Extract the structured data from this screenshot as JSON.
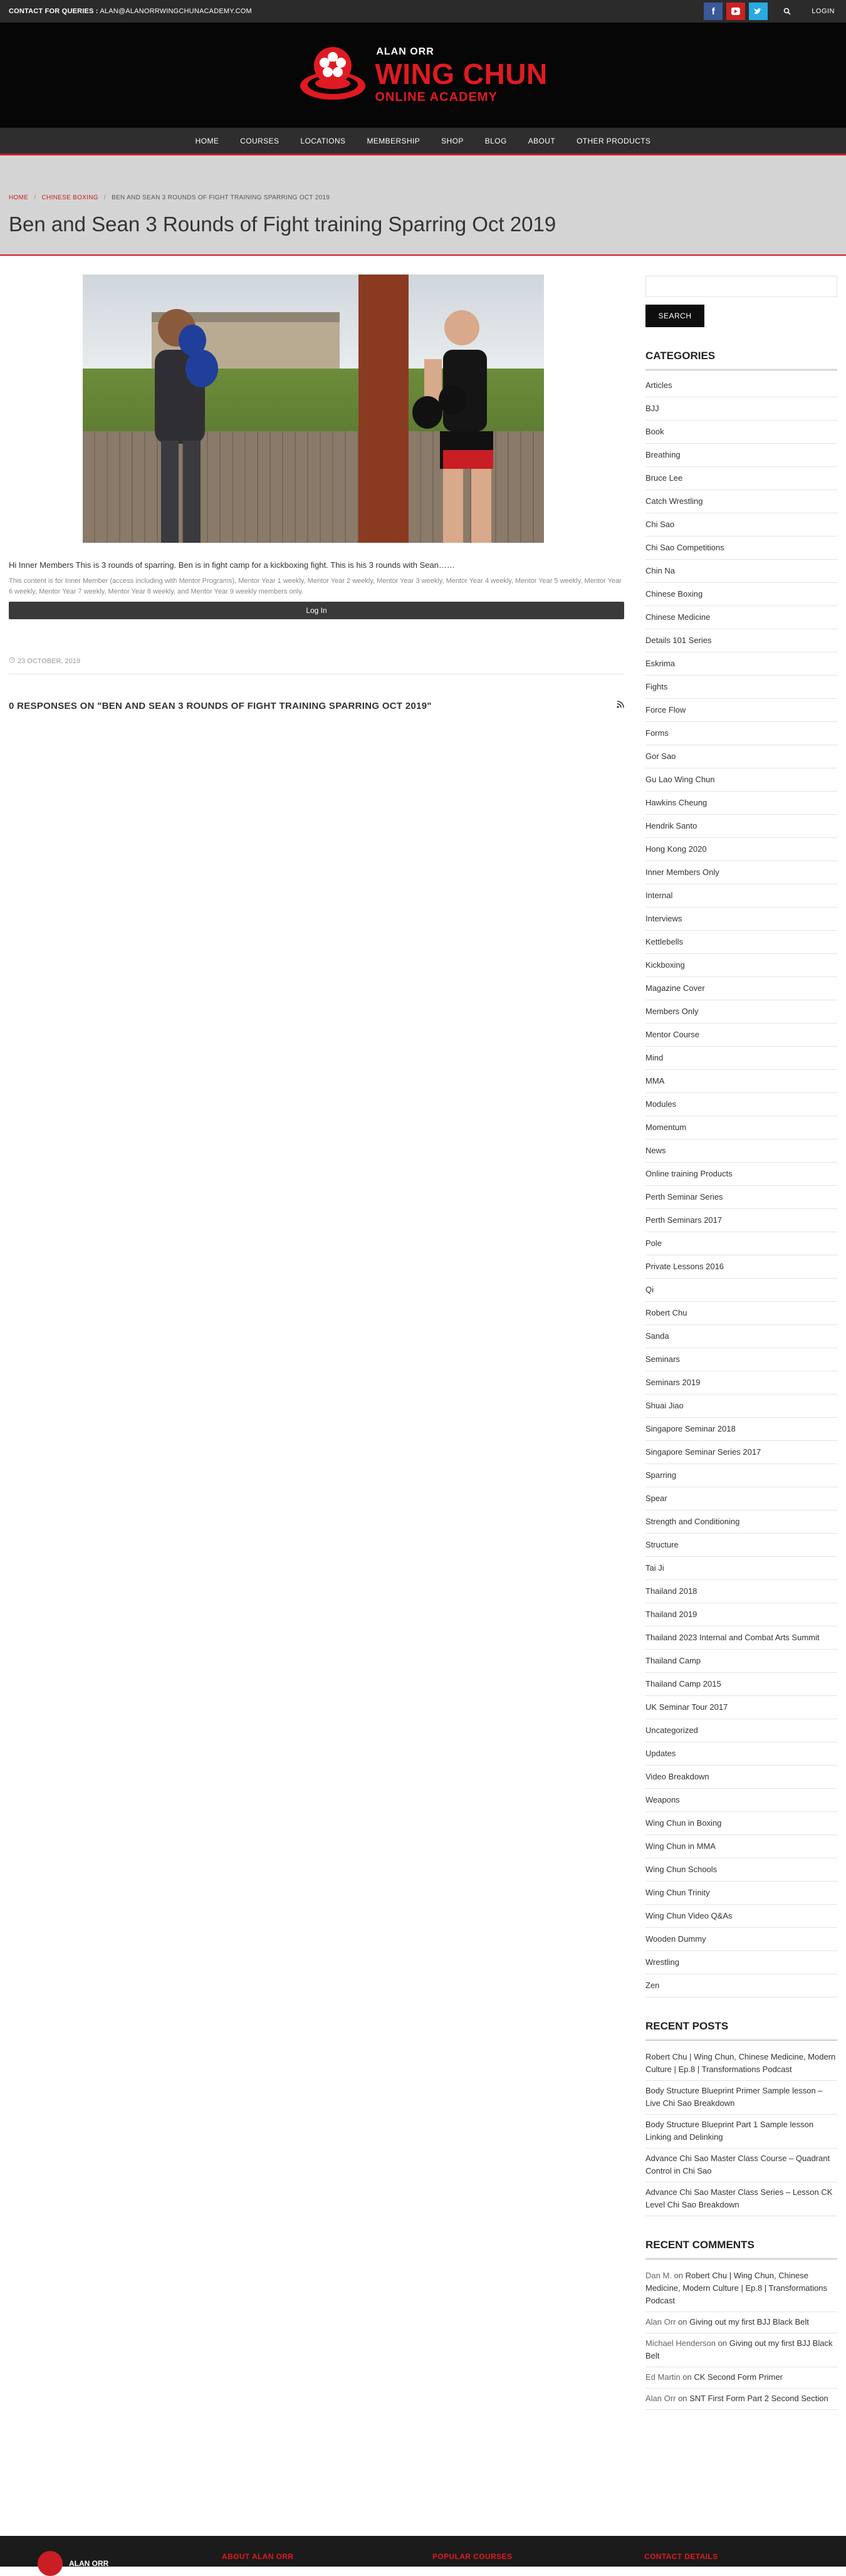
{
  "topbar": {
    "contact_label": "CONTACT FOR QUERIES :",
    "contact_email": "ALAN@ALANORRWINGCHUNACADEMY.COM",
    "login": "LOGIN"
  },
  "header": {
    "logo_line1": "ALAN ORR",
    "logo_line2": "WING CHUN",
    "logo_line3": "ONLINE ACADEMY"
  },
  "nav": [
    "HOME",
    "COURSES",
    "LOCATIONS",
    "MEMBERSHIP",
    "SHOP",
    "BLOG",
    "ABOUT",
    "OTHER PRODUCTS"
  ],
  "breadcrumb": {
    "home": "HOME",
    "category": "CHINESE BOXING",
    "current": "BEN AND SEAN 3 ROUNDS OF FIGHT TRAINING SPARRING OCT 2019"
  },
  "page_title": "Ben and Sean 3 Rounds of Fight training Sparring Oct 2019",
  "post": {
    "body": "Hi Inner Members This is 3 rounds of sparring. Ben is in fight camp for a kickboxing fight. This is his 3 rounds with Sean……",
    "notice": "This content is for Inner Member (access including with Mentor Programs), Mentor Year 1 weekly, Mentor Year 2 weekly, Mentor Year 3 weekly, Mentor Year 4 weekly, Mentor Year 5 weekly, Mentor Year 6 weekly, Mentor Year 7 weekly, Mentor Year 8 weekly, and Mentor Year 9 weekly members only.",
    "login_button": "Log In",
    "date": "23 OCTOBER, 2019",
    "responses": "0 RESPONSES ON \"BEN AND SEAN 3 ROUNDS OF FIGHT TRAINING SPARRING OCT 2019\""
  },
  "sidebar": {
    "search_button": "SEARCH",
    "categories_title": "CATEGORIES",
    "categories": [
      "Articles",
      "BJJ",
      "Book",
      "Breathing",
      "Bruce Lee",
      "Catch Wrestling",
      "Chi Sao",
      "Chi Sao Competitions",
      "Chin Na",
      "Chinese Boxing",
      "Chinese Medicine",
      "Details 101 Series",
      "Eskrima",
      "Fights",
      "Force Flow",
      "Forms",
      "Gor Sao",
      "Gu Lao Wing Chun",
      "Hawkins Cheung",
      "Hendrik Santo",
      "Hong Kong 2020",
      "Inner Members Only",
      "Internal",
      "Interviews",
      "Kettlebells",
      "Kickboxing",
      "Magazine Cover",
      "Members Only",
      "Mentor Course",
      "Mind",
      "MMA",
      "Modules",
      "Momentum",
      "News",
      "Online training Products",
      "Perth Seminar Series",
      "Perth Seminars 2017",
      "Pole",
      "Private Lessons 2016",
      "Qi",
      "Robert Chu",
      "Sanda",
      "Seminars",
      "Seminars 2019",
      "Shuai Jiao",
      "Singapore Seminar 2018",
      "Singapore Seminar Series 2017",
      "Sparring",
      "Spear",
      "Strength and Conditioning",
      "Structure",
      "Tai Ji",
      "Thailand 2018",
      "Thailand 2019",
      "Thailand 2023 Internal and Combat Arts Summit",
      "Thailand Camp",
      "Thailand Camp 2015",
      "UK Seminar Tour 2017",
      "Uncategorized",
      "Updates",
      "Video Breakdown",
      "Weapons",
      "Wing Chun in Boxing",
      "Wing Chun in MMA",
      "Wing Chun Schools",
      "Wing Chun Trinity",
      "Wing Chun Video Q&As",
      "Wooden Dummy",
      "Wrestling",
      "Zen"
    ],
    "recent_posts_title": "RECENT POSTS",
    "recent_posts": [
      "Robert Chu | Wing Chun, Chinese Medicine, Modern Culture | Ep.8 | Transformations Podcast",
      "Body Structure Blueprint Primer Sample lesson – Live Chi Sao Breakdown",
      "Body Structure Blueprint Part 1 Sample lesson Linking and Delinking",
      "Advance Chi Sao Master Class Course – Quadrant Control in Chi Sao",
      "Advance Chi Sao Master Class Series – Lesson CK Level Chi Sao Breakdown"
    ],
    "recent_comments_title": "RECENT COMMENTS",
    "recent_comments": [
      {
        "author": "Dan M.",
        "on": "on",
        "post": "Robert Chu | Wing Chun, Chinese Medicine, Modern Culture | Ep.8 | Transformations Podcast"
      },
      {
        "author": "Alan Orr",
        "on": "on",
        "post": "Giving out my first BJJ Black Belt"
      },
      {
        "author": "Michael Henderson",
        "on": "on",
        "post": "Giving out my first BJJ Black Belt"
      },
      {
        "author": "Ed Martin",
        "on": "on",
        "post": "CK Second Form Primer"
      },
      {
        "author": "Alan Orr",
        "on": "on",
        "post": "SNT First Form Part 2 Second Section"
      }
    ]
  },
  "footer": {
    "logo_text": "ALAN ORR",
    "col1": "ABOUT ALAN ORR",
    "col2": "POPULAR COURSES",
    "col3": "CONTACT DETAILS"
  },
  "colors": {
    "accent": "#c81e24",
    "dark": "#2b2b2b",
    "header_bg": "#060606"
  }
}
